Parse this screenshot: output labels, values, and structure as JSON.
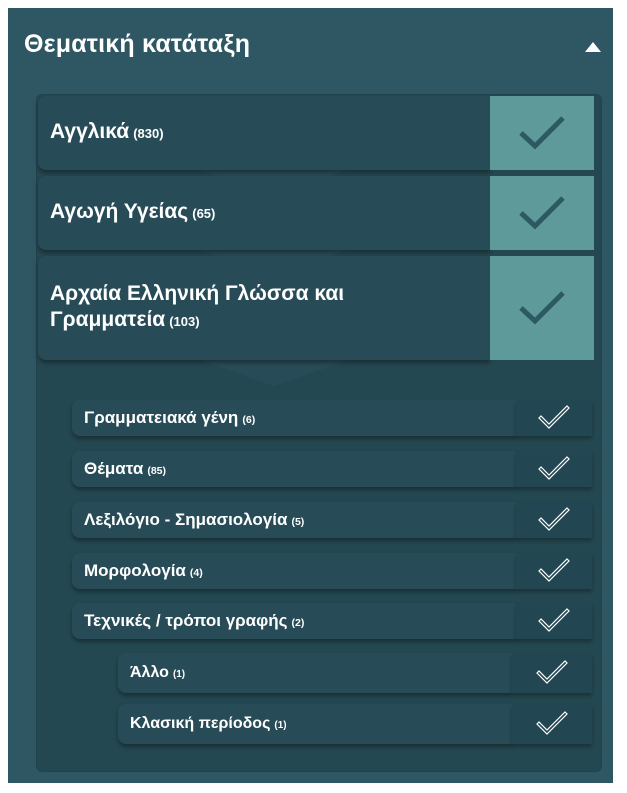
{
  "panel": {
    "title": "Θεματική κατάταξη",
    "collapse_icon": "caret-up-icon"
  },
  "categories": [
    {
      "label": "Αγγλικά",
      "count": "(830)",
      "selected": true
    },
    {
      "label": "Αγωγή Υγείας",
      "count": "(65)",
      "selected": true
    },
    {
      "label": "Αρχαία Ελληνική Γλώσσα και Γραμματεία",
      "count": "(103)",
      "selected": true,
      "children": [
        {
          "label": "Γραμματειακά γένη",
          "count": "(6)"
        },
        {
          "label": "Θέματα",
          "count": "(85)"
        },
        {
          "label": "Λεξιλόγιο - Σημασιολογία",
          "count": "(5)"
        },
        {
          "label": "Μορφολογία",
          "count": "(4)"
        },
        {
          "label": "Τεχνικές / τρόποι γραφής",
          "count": "(2)",
          "children": [
            {
              "label": "Άλλο",
              "count": "(1)"
            },
            {
              "label": "Κλασική περίοδος",
              "count": "(1)"
            }
          ]
        }
      ]
    }
  ],
  "colors": {
    "panel_bg": "#2e5763",
    "row_bg": "#284c57",
    "check_selected_bg": "#5f9a9b",
    "check_mark": "#2c5a62",
    "check_outline": "#ffffff"
  },
  "icons": {
    "check": "check-mark-icon",
    "check_outline": "check-outline-icon",
    "chevron": "chevron-down-icon"
  }
}
